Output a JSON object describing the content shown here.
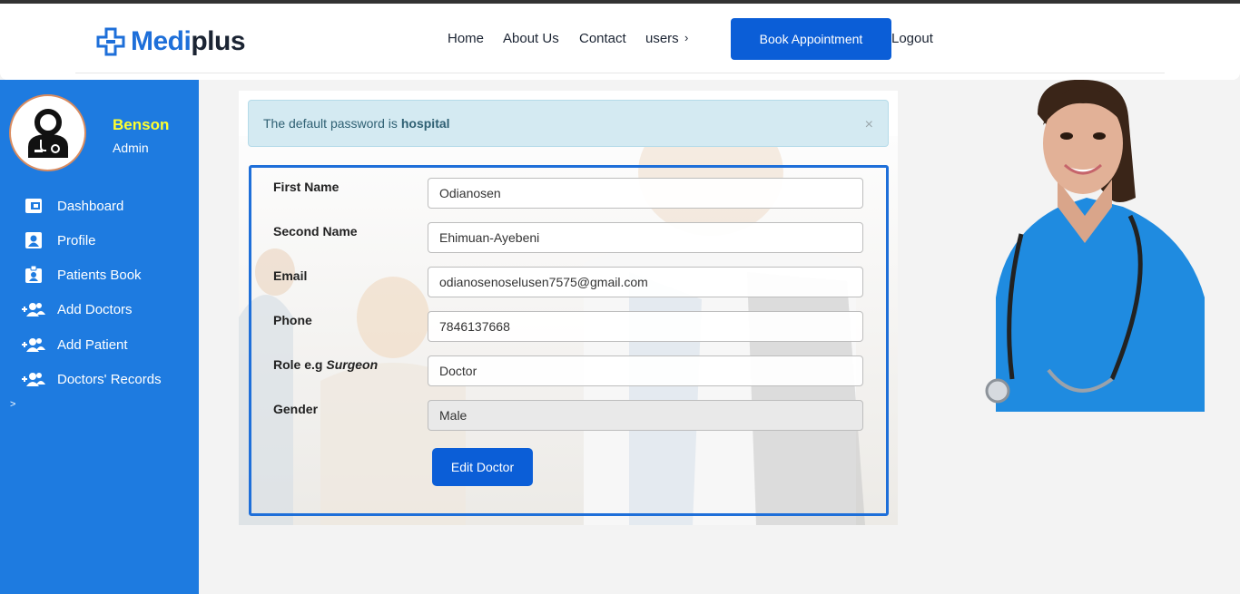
{
  "brand": {
    "part1": "Medi",
    "part2": "plus",
    "primary": "#1e6fd9",
    "dark": "#1b2433"
  },
  "nav": {
    "home": "Home",
    "about": "About Us",
    "contact": "Contact",
    "users": "users",
    "users_chevron": "›",
    "book": "Book Appointment",
    "logout": "Logout"
  },
  "user": {
    "name": "Benson",
    "role": "Admin"
  },
  "sidebar": {
    "items": [
      {
        "label": "Dashboard",
        "icon": "dashboard-icon"
      },
      {
        "label": "Profile",
        "icon": "profile-icon"
      },
      {
        "label": "Patients Book",
        "icon": "patients-book-icon"
      },
      {
        "label": "Add Doctors",
        "icon": "add-users-icon"
      },
      {
        "label": "Add Patient",
        "icon": "add-users-icon"
      },
      {
        "label": "Doctors' Records",
        "icon": "add-users-icon"
      }
    ],
    "arrow": ">"
  },
  "alert": {
    "text": "The default password is",
    "strong": "hospital",
    "close": "×"
  },
  "form": {
    "first_name": {
      "label": "First Name",
      "value": "Odianosen"
    },
    "second_name": {
      "label": "Second Name",
      "value": "Ehimuan-Ayebeni"
    },
    "email": {
      "label": "Email",
      "value": "odianosenoselusen7575@gmail.com"
    },
    "phone": {
      "label": "Phone",
      "value": "7846137668"
    },
    "role": {
      "label": "Role e.g",
      "label_em": "Surgeon",
      "value": "Doctor"
    },
    "gender": {
      "label": "Gender",
      "value": "Male"
    },
    "submit": "Edit Doctor"
  },
  "colors": {
    "sidebar": "#1e7be0",
    "button": "#0b5ed7",
    "user_name": "#ffff2e",
    "alert_bg": "#d4eaf2"
  }
}
